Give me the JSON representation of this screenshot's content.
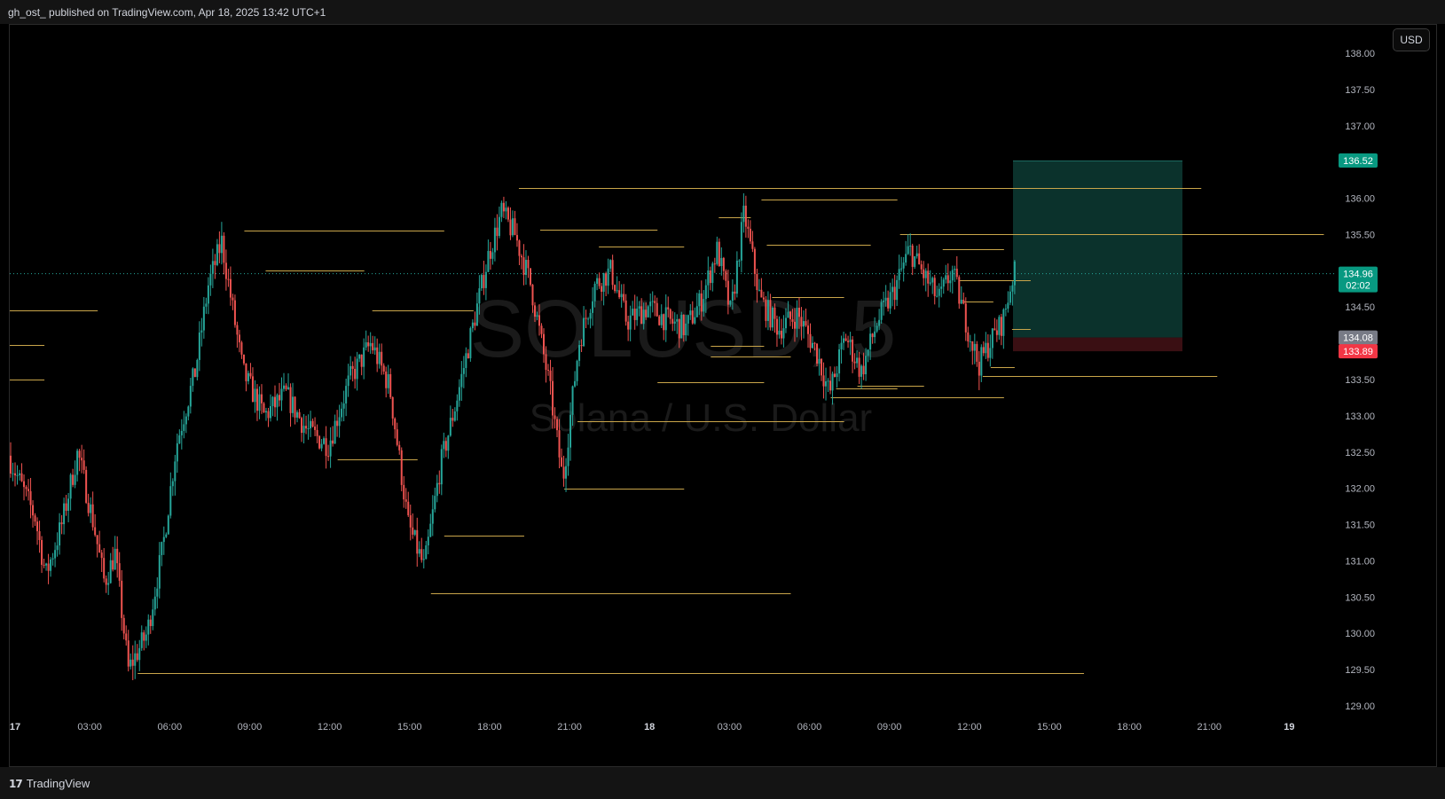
{
  "header": {
    "publish_line": "gh_ost_ published on TradingView.com, Apr 18, 2025 13:42 UTC+1"
  },
  "watermark": {
    "symbol": "SOLUSD, 5",
    "name": "Solana / U.S. Dollar"
  },
  "currency_button": "USD",
  "footer": {
    "brand_logo": "17",
    "brand_name": "TradingView"
  },
  "price_axis": {
    "ticks": [
      "138.00",
      "137.50",
      "137.00",
      "136.50",
      "136.00",
      "135.50",
      "135.00",
      "134.50",
      "134.00",
      "133.50",
      "133.00",
      "132.50",
      "132.00",
      "131.50",
      "131.00",
      "130.50",
      "130.00",
      "129.50",
      "129.00"
    ],
    "labels": {
      "target": "136.52",
      "last": "134.96",
      "countdown": "02:02",
      "entry": "134.08",
      "stop": "133.89"
    }
  },
  "time_axis": {
    "ticks": [
      {
        "label": "17",
        "bold": true
      },
      {
        "label": "03:00",
        "bold": false
      },
      {
        "label": "06:00",
        "bold": false
      },
      {
        "label": "09:00",
        "bold": false
      },
      {
        "label": "12:00",
        "bold": false
      },
      {
        "label": "15:00",
        "bold": false
      },
      {
        "label": "18:00",
        "bold": false
      },
      {
        "label": "21:00",
        "bold": false
      },
      {
        "label": "18",
        "bold": true
      },
      {
        "label": "03:00",
        "bold": false
      },
      {
        "label": "06:00",
        "bold": false
      },
      {
        "label": "09:00",
        "bold": false
      },
      {
        "label": "12:00",
        "bold": false
      },
      {
        "label": "15:00",
        "bold": false
      },
      {
        "label": "18:00",
        "bold": false
      },
      {
        "label": "21:00",
        "bold": false
      },
      {
        "label": "19",
        "bold": true
      }
    ]
  },
  "colors": {
    "up": "#26a69a",
    "down": "#ef5350",
    "level_line": "#c9a54a",
    "target_zone": "#0d3b34",
    "stop_zone": "#3a0f13",
    "target_label": "#089981",
    "stop_label": "#f23645",
    "entry_label": "#787b86"
  },
  "chart_data": {
    "type": "candlestick",
    "symbol": "SOLUSD",
    "timeframe": "5",
    "price_range": [
      129.0,
      138.0
    ],
    "last_price": 134.96,
    "position": {
      "side": "long",
      "entry": 134.08,
      "target": 136.52,
      "stop": 133.89
    },
    "price_path": [
      [
        0,
        132.45
      ],
      [
        1.0,
        131.6
      ],
      [
        1.4,
        130.8
      ],
      [
        2.0,
        131.5
      ],
      [
        2.6,
        132.5
      ],
      [
        3.2,
        131.5
      ],
      [
        3.6,
        130.7
      ],
      [
        4.0,
        131.1
      ],
      [
        4.5,
        129.5
      ],
      [
        5.2,
        130.0
      ],
      [
        5.8,
        131.2
      ],
      [
        6.3,
        132.6
      ],
      [
        7.0,
        133.6
      ],
      [
        7.5,
        134.8
      ],
      [
        8.0,
        135.4
      ],
      [
        8.8,
        133.6
      ],
      [
        9.6,
        133.0
      ],
      [
        10.4,
        133.3
      ],
      [
        11.2,
        132.8
      ],
      [
        12.0,
        132.6
      ],
      [
        12.8,
        133.5
      ],
      [
        13.6,
        134.0
      ],
      [
        14.3,
        133.4
      ],
      [
        15.0,
        131.5
      ],
      [
        15.6,
        130.9
      ],
      [
        16.2,
        132.3
      ],
      [
        16.8,
        133.2
      ],
      [
        17.4,
        134.2
      ],
      [
        18.0,
        135.2
      ],
      [
        18.5,
        135.8
      ],
      [
        19.0,
        135.5
      ],
      [
        19.6,
        134.8
      ],
      [
        20.3,
        133.4
      ],
      [
        20.8,
        132.1
      ],
      [
        21.4,
        134.0
      ],
      [
        22.0,
        134.8
      ],
      [
        22.6,
        135.0
      ],
      [
        23.2,
        134.3
      ],
      [
        24.0,
        134.5
      ],
      [
        24.8,
        134.3
      ],
      [
        25.4,
        134.2
      ],
      [
        26.0,
        134.6
      ],
      [
        26.6,
        135.3
      ],
      [
        27.1,
        134.4
      ],
      [
        27.6,
        135.8
      ],
      [
        28.2,
        134.6
      ],
      [
        28.9,
        134.2
      ],
      [
        29.6,
        134.4
      ],
      [
        30.3,
        133.9
      ],
      [
        30.8,
        133.3
      ],
      [
        31.4,
        134.1
      ],
      [
        32.0,
        133.6
      ],
      [
        32.6,
        134.3
      ],
      [
        33.2,
        134.7
      ],
      [
        33.8,
        135.3
      ],
      [
        34.4,
        134.9
      ],
      [
        34.9,
        134.6
      ],
      [
        35.4,
        135.0
      ],
      [
        36.0,
        134.2
      ],
      [
        36.4,
        133.7
      ],
      [
        36.8,
        134.0
      ],
      [
        37.3,
        134.3
      ],
      [
        37.7,
        134.96
      ]
    ],
    "levels": [
      {
        "x0": 0,
        "x1": 3.3,
        "price": 134.45
      },
      {
        "x0": 0,
        "x1": 1.3,
        "price": 133.98
      },
      {
        "x0": 0,
        "x1": 1.3,
        "price": 133.5
      },
      {
        "x0": 4.8,
        "x1": 40.3,
        "price": 129.45
      },
      {
        "x0": 8.8,
        "x1": 16.3,
        "price": 135.55
      },
      {
        "x0": 9.6,
        "x1": 13.3,
        "price": 135.0
      },
      {
        "x0": 12.3,
        "x1": 15.3,
        "price": 132.4
      },
      {
        "x0": 13.6,
        "x1": 17.4,
        "price": 134.45
      },
      {
        "x0": 15.8,
        "x1": 29.3,
        "price": 130.55
      },
      {
        "x0": 16.3,
        "x1": 19.3,
        "price": 131.35
      },
      {
        "x0": 19.1,
        "x1": 44.7,
        "price": 136.14
      },
      {
        "x0": 19.9,
        "x1": 24.3,
        "price": 135.57
      },
      {
        "x0": 20.8,
        "x1": 25.3,
        "price": 132.0
      },
      {
        "x0": 21.3,
        "x1": 31.3,
        "price": 132.92
      },
      {
        "x0": 22.1,
        "x1": 25.3,
        "price": 135.33
      },
      {
        "x0": 24.3,
        "x1": 28.3,
        "price": 133.46
      },
      {
        "x0": 26.3,
        "x1": 28.3,
        "price": 133.97
      },
      {
        "x0": 26.3,
        "x1": 29.3,
        "price": 133.82
      },
      {
        "x0": 26.6,
        "x1": 27.8,
        "price": 135.74
      },
      {
        "x0": 28.2,
        "x1": 33.3,
        "price": 135.98
      },
      {
        "x0": 28.4,
        "x1": 32.3,
        "price": 135.36
      },
      {
        "x0": 28.6,
        "x1": 31.3,
        "price": 134.64
      },
      {
        "x0": 30.8,
        "x1": 37.3,
        "price": 133.25
      },
      {
        "x0": 31.0,
        "x1": 33.3,
        "price": 133.38
      },
      {
        "x0": 31.8,
        "x1": 34.3,
        "price": 133.42
      },
      {
        "x0": 33.4,
        "x1": 49.3,
        "price": 135.5
      },
      {
        "x0": 35.0,
        "x1": 37.3,
        "price": 135.3
      },
      {
        "x0": 35.6,
        "x1": 38.3,
        "price": 134.87
      },
      {
        "x0": 35.8,
        "x1": 36.9,
        "price": 134.57
      },
      {
        "x0": 36.5,
        "x1": 45.3,
        "price": 133.55
      },
      {
        "x0": 36.8,
        "x1": 37.7,
        "price": 133.67
      },
      {
        "x0": 37.6,
        "x1": 38.3,
        "price": 134.2
      }
    ]
  }
}
